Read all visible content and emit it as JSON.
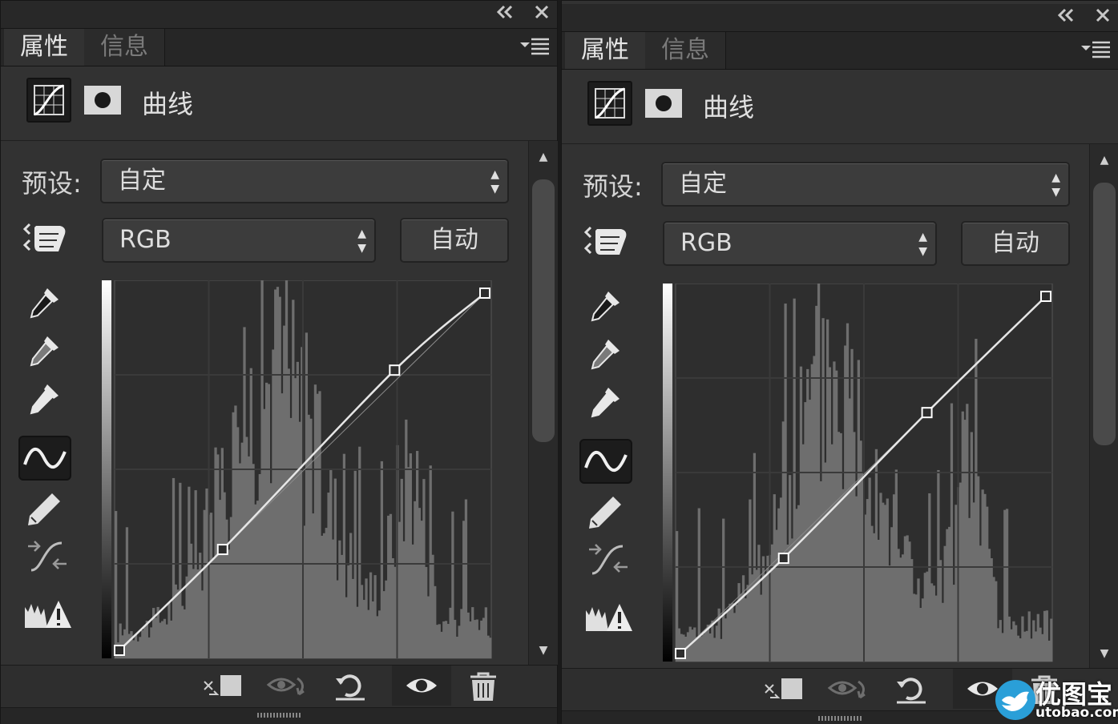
{
  "panels": [
    {
      "titlebar": {
        "collapse_icon": "double-left-chevron-icon",
        "close_icon": "close-icon"
      },
      "tabs": [
        {
          "label": "属性",
          "active": true
        },
        {
          "label": "信息",
          "active": false
        }
      ],
      "panel_menu_icon": "panel-menu-icon",
      "adjustment": {
        "title": "曲线"
      },
      "preset": {
        "label": "预设:",
        "value": "自定"
      },
      "channel": {
        "value": "RGB"
      },
      "auto_label": "自动",
      "curve_points": [
        [
          0,
          0
        ],
        [
          72,
          72
        ],
        [
          192,
          200
        ],
        [
          255,
          255
        ]
      ]
    },
    {
      "titlebar": {
        "collapse_icon": "double-left-chevron-icon",
        "close_icon": "close-icon"
      },
      "tabs": [
        {
          "label": "属性",
          "active": true
        },
        {
          "label": "信息",
          "active": false
        }
      ],
      "panel_menu_icon": "panel-menu-icon",
      "adjustment": {
        "title": "曲线"
      },
      "preset": {
        "label": "预设:",
        "value": "自定"
      },
      "channel": {
        "value": "RGB"
      },
      "auto_label": "自动",
      "curve_points": [
        [
          0,
          0
        ],
        [
          72,
          68
        ],
        [
          172,
          172
        ],
        [
          255,
          255
        ]
      ]
    }
  ],
  "watermark": {
    "name": "优图宝",
    "url": "utobao.com"
  },
  "colors": {
    "panel_bg": "#323232",
    "graph_bg": "#2e2e2e",
    "histogram": "#6e6e6e",
    "curve": "#e6e6e6"
  }
}
